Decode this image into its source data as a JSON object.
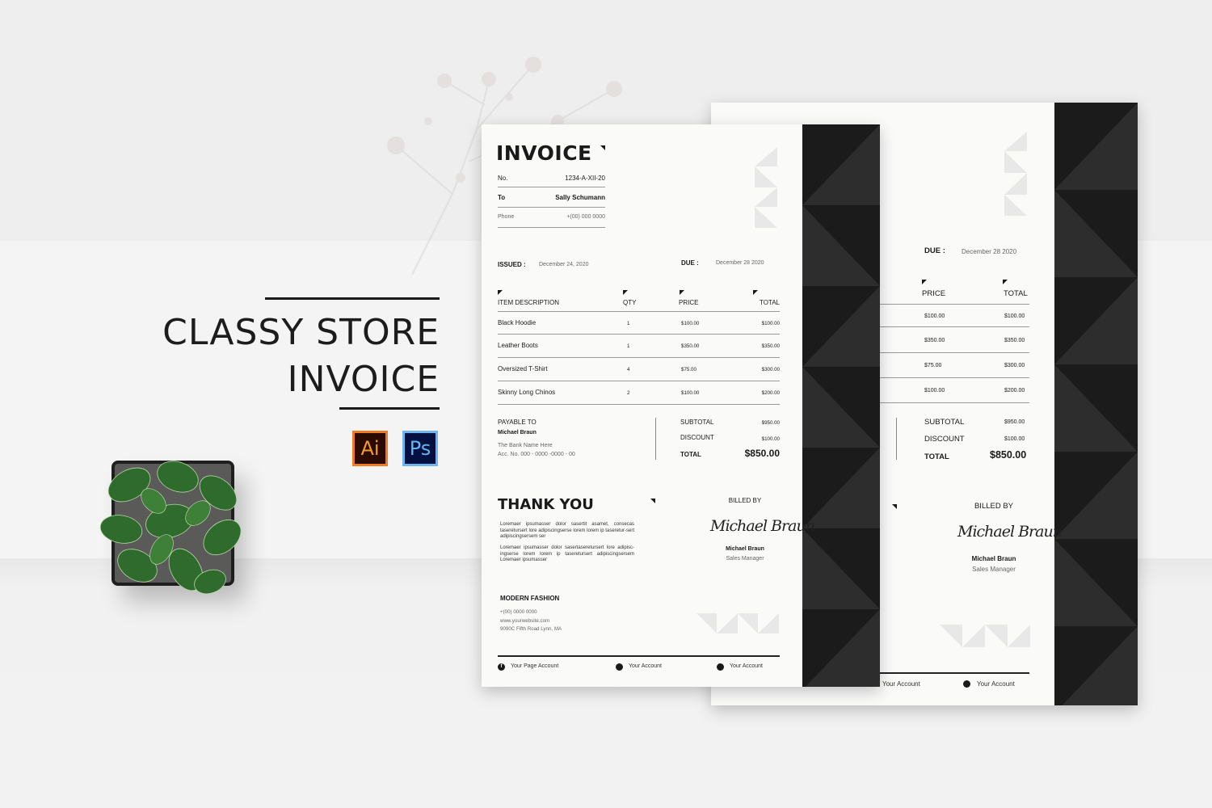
{
  "promo": {
    "title_line1": "CLASSY STORE",
    "title_line2": "INVOICE",
    "badges": [
      {
        "label": "Ai",
        "name": "illustrator-icon",
        "colors": {
          "bg": "#2b0a00",
          "fg": "#f39a2b"
        }
      },
      {
        "label": "Ps",
        "name": "photoshop-icon",
        "colors": {
          "bg": "#031040",
          "fg": "#62b6f3"
        }
      }
    ]
  },
  "invoice": {
    "title": "INVOICE",
    "no_label": "No.",
    "no_value": "1234-A-XII-20",
    "to_label": "To",
    "to_value": "Sally Schumann",
    "phone_label": "Phone",
    "phone_value": "+(00) 000 0000",
    "issued_label": "ISSUED :",
    "issued_value": "December 24, 2020",
    "due_label": "DUE :",
    "due_value": "December 28 2020",
    "columns": [
      "ITEM DESCRIPTION",
      "QTY",
      "PRICE",
      "TOTAL"
    ],
    "items": [
      {
        "description": "Black Hoodie",
        "qty": "1",
        "price": "$100.00",
        "total": "$100.00"
      },
      {
        "description": "Leather Boots",
        "qty": "1",
        "price": "$350.00",
        "total": "$350.00"
      },
      {
        "description": "Oversized T-Shirt",
        "qty": "4",
        "price": "$75.00",
        "total": "$300.00"
      },
      {
        "description": "Skinny Long Chinos",
        "qty": "2",
        "price": "$100.00",
        "total": "$200.00"
      }
    ],
    "payable_label": "PAYABLE TO",
    "payable_name": "Michael Braun",
    "bank_name": "The Bank Name Here",
    "account_no": "Acc. No. 000 - 0000 -0000 - 00",
    "subtotal_label": "SUBTOTAL",
    "subtotal_value": "$950.00",
    "discount_label": "DISCOUNT",
    "discount_value": "$100.00",
    "total_label": "TOTAL",
    "total_value": "$850.00",
    "thank_you": "THANK YOU",
    "lorem_1": "Loremaer ipsumasser dolor sasertit asamet, consecas taseretursert lore adipiscingserse lorem lorem ip taseretur-sert adipiscingsersem ser",
    "lorem_2": "Loremaer ipsumasser dolor sasertaseretursert lore adipisc-ingserse lorem lorem ip taseretursert adipiscingsersem Loremaer ipsumasser",
    "billed_by_label": "BILLED BY",
    "signature": "Michael Braun",
    "biller_name": "Michael Braun",
    "biller_role": "Sales Manager",
    "company": "MODERN FASHION",
    "company_phone": "+(00) 0000 0000",
    "company_web": "www.yourwebsite.com",
    "company_address": "9090C Fifth Road Lynn, MA",
    "social": [
      {
        "icon": "facebook-icon",
        "glyph": "f",
        "label": "Your Page Account"
      },
      {
        "icon": "instagram-icon",
        "glyph": "◙",
        "label": "Your Account"
      },
      {
        "icon": "social-account-icon",
        "glyph": "◘",
        "label": "Your Account"
      }
    ]
  },
  "colors": {
    "dark_strip": "#1b1b1b",
    "dark_triangle": "#2d2d2d",
    "paper": "#fafaf9",
    "background": "#eeeeee"
  }
}
